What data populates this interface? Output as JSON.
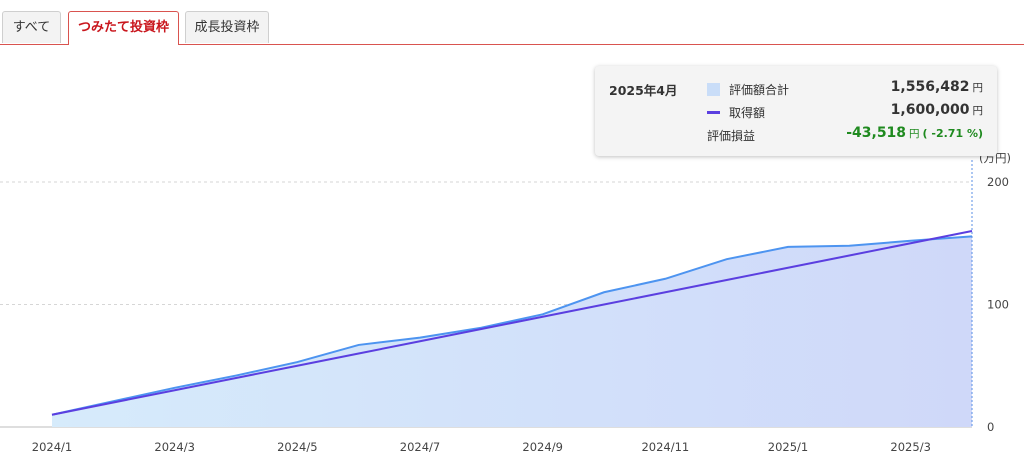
{
  "tabs": [
    {
      "label": "すべて",
      "active": false
    },
    {
      "label": "つみたて投資枠",
      "active": true
    },
    {
      "label": "成長投資枠",
      "active": false
    }
  ],
  "tooltip": {
    "period": "2025年4月",
    "rows": [
      {
        "label": "評価額合計",
        "value": "1,556,482",
        "unit": "円"
      },
      {
        "label": "取得額",
        "value": "1,600,000",
        "unit": "円"
      },
      {
        "label": "評価損益",
        "value": "-43,518",
        "unit": "円",
        "pct": "( -2.71 %)"
      }
    ]
  },
  "colors": {
    "accent": "#c9161d",
    "area_fill": "#c9ddf8",
    "area_line": "#4d94f0",
    "cost_line": "#5b3fe0",
    "loss_text": "#1f8a1f"
  },
  "chart_data": {
    "type": "area",
    "y_unit_label": "(万円)",
    "ylim": [
      0,
      200
    ],
    "yticks": [
      0,
      100,
      200
    ],
    "x": [
      "2024/1",
      "2024/2",
      "2024/3",
      "2024/4",
      "2024/5",
      "2024/6",
      "2024/7",
      "2024/8",
      "2024/9",
      "2024/10",
      "2024/11",
      "2024/12",
      "2025/1",
      "2025/2",
      "2025/3",
      "2025/4"
    ],
    "x_tick_labels": [
      "2024/1",
      "2024/3",
      "2024/5",
      "2024/7",
      "2024/9",
      "2024/11",
      "2025/1",
      "2025/3"
    ],
    "series": [
      {
        "name": "評価額合計",
        "style": "area",
        "values": [
          10,
          21,
          32,
          42,
          53,
          67,
          73,
          81,
          92,
          110,
          121,
          137,
          147,
          148,
          152,
          155.6
        ]
      },
      {
        "name": "取得額",
        "style": "line",
        "values": [
          10,
          20,
          30,
          40,
          50,
          60,
          70,
          80,
          90,
          100,
          110,
          120,
          130,
          140,
          150,
          160
        ]
      }
    ],
    "grid": true,
    "legend": "tooltip (top-right)"
  }
}
